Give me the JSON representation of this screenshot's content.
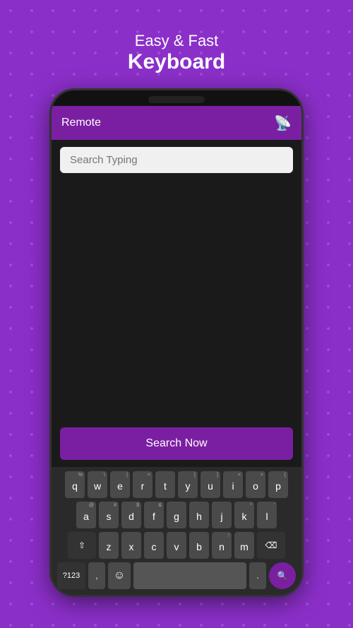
{
  "header": {
    "subtitle": "Easy & Fast",
    "title": "Keyboard"
  },
  "app": {
    "title": "Remote",
    "cast_icon": "⊟",
    "search_placeholder": "Search Typing",
    "search_now_label": "Search Now"
  },
  "keyboard": {
    "rows": [
      [
        {
          "symbol": "%",
          "letter": "q"
        },
        {
          "symbol": "\\",
          "letter": "w"
        },
        {
          "symbol": "|",
          "letter": "e"
        },
        {
          "symbol": "=",
          "letter": "r"
        },
        {
          "symbol": "",
          "letter": "t"
        },
        {
          "symbol": "[",
          "letter": "y"
        },
        {
          "symbol": "]",
          "letter": "u"
        },
        {
          "symbol": "<",
          "letter": "i"
        },
        {
          "symbol": ">",
          "letter": "o"
        },
        {
          "symbol": "{",
          "letter": "p"
        }
      ],
      [
        {
          "symbol": "@",
          "letter": "a"
        },
        {
          "symbol": "#",
          "letter": "s"
        },
        {
          "symbol": "$",
          "letter": "d"
        },
        {
          "symbol": "&",
          "letter": "f"
        },
        {
          "symbol": "",
          "letter": "g"
        },
        {
          "symbol": "",
          "letter": "h"
        },
        {
          "symbol": "",
          "letter": "j"
        },
        {
          "symbol": "*",
          "letter": "k"
        },
        {
          "symbol": "'",
          "letter": "l"
        }
      ],
      [
        {
          "symbol": "",
          "letter": "z"
        },
        {
          "symbol": "",
          "letter": "x"
        },
        {
          "symbol": "",
          "letter": "c"
        },
        {
          "symbol": "",
          "letter": "v"
        },
        {
          "symbol": "",
          "letter": "b"
        },
        {
          "symbol": "!",
          "letter": "n"
        },
        {
          "symbol": "",
          "letter": "m"
        }
      ]
    ],
    "numbers_label": "?123",
    "space_label": "",
    "backspace_icon": "⌫",
    "shift_icon": "⇧",
    "search_icon": "🔍"
  },
  "colors": {
    "purple": "#7B1FA2",
    "bg_purple": "#8B2FC9"
  }
}
